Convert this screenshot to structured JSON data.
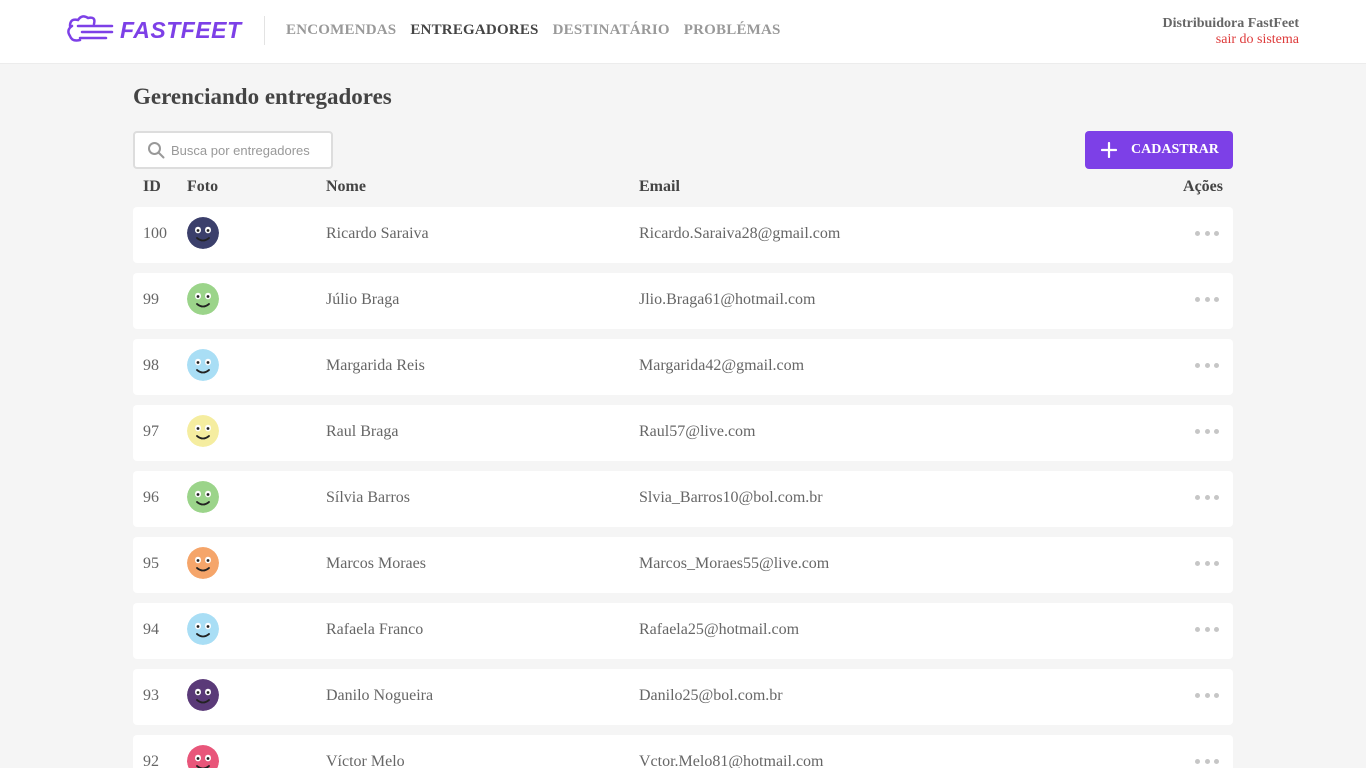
{
  "brand": {
    "name": "FASTFEET",
    "accent": "#7d40e7"
  },
  "nav": [
    {
      "label": "ENCOMENDAS",
      "active": false
    },
    {
      "label": "ENTREGADORES",
      "active": true
    },
    {
      "label": "DESTINATÁRIO",
      "active": false
    },
    {
      "label": "PROBLÉMAS",
      "active": false
    }
  ],
  "user": {
    "name": "Distribuidora FastFeet",
    "logout": "sair do sistema"
  },
  "page": {
    "title": "Gerenciando entregadores"
  },
  "search": {
    "placeholder": "Busca por entregadores",
    "icon": "search-icon"
  },
  "register_button": {
    "label": "CADASTRAR",
    "icon": "plus-icon"
  },
  "table": {
    "headers": {
      "id": "ID",
      "photo": "Foto",
      "name": "Nome",
      "email": "Email",
      "actions": "Ações"
    },
    "rows": [
      {
        "id": "100",
        "name": "Ricardo Saraiva",
        "email": "Ricardo.Saraiva28@gmail.com",
        "avatar_color": "#3b3f6b"
      },
      {
        "id": "99",
        "name": "Júlio Braga",
        "email": "Jlio.Braga61@hotmail.com",
        "avatar_color": "#9bd48a"
      },
      {
        "id": "98",
        "name": "Margarida Reis",
        "email": "Margarida42@gmail.com",
        "avatar_color": "#a9def5"
      },
      {
        "id": "97",
        "name": "Raul Braga",
        "email": "Raul57@live.com",
        "avatar_color": "#f5eda0"
      },
      {
        "id": "96",
        "name": "Sílvia Barros",
        "email": "Slvia_Barros10@bol.com.br",
        "avatar_color": "#9bd48a"
      },
      {
        "id": "95",
        "name": "Marcos Moraes",
        "email": "Marcos_Moraes55@live.com",
        "avatar_color": "#f5a56a"
      },
      {
        "id": "94",
        "name": "Rafaela Franco",
        "email": "Rafaela25@hotmail.com",
        "avatar_color": "#a9def5"
      },
      {
        "id": "93",
        "name": "Danilo Nogueira",
        "email": "Danilo25@bol.com.br",
        "avatar_color": "#5a3a78"
      },
      {
        "id": "92",
        "name": "Víctor Melo",
        "email": "Vctor.Melo81@hotmail.com",
        "avatar_color": "#e8567a"
      }
    ]
  }
}
